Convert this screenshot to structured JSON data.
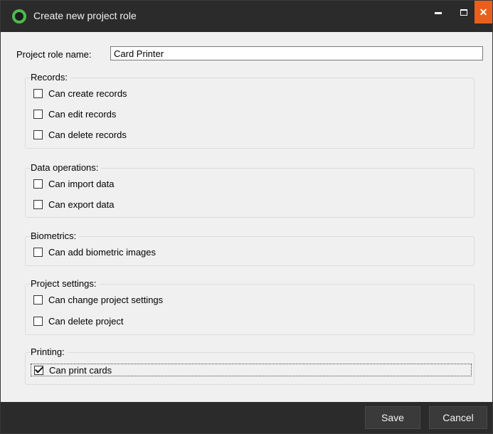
{
  "window": {
    "title": "Create new project role",
    "controls": {
      "minimize": "minimize-icon",
      "maximize": "maximize-icon",
      "close": "✕"
    },
    "close_color": "#e8601c"
  },
  "form": {
    "name_label": "Project role name:",
    "name_value": "Card Printer"
  },
  "groups": [
    {
      "label": "Records:",
      "items": [
        {
          "label": "Can create records",
          "checked": false
        },
        {
          "label": "Can edit records",
          "checked": false
        },
        {
          "label": "Can delete records",
          "checked": false
        }
      ]
    },
    {
      "label": "Data operations:",
      "items": [
        {
          "label": "Can import data",
          "checked": false
        },
        {
          "label": "Can export data",
          "checked": false
        }
      ]
    },
    {
      "label": "Biometrics:",
      "items": [
        {
          "label": "Can add biometric images",
          "checked": false
        }
      ]
    },
    {
      "label": "Project settings:",
      "items": [
        {
          "label": "Can change project settings",
          "checked": false
        },
        {
          "label": "Can delete project",
          "checked": false
        }
      ]
    },
    {
      "label": "Printing:",
      "items": [
        {
          "label": "Can print cards",
          "checked": true
        }
      ]
    }
  ],
  "buttons": {
    "save": "Save",
    "cancel": "Cancel"
  }
}
